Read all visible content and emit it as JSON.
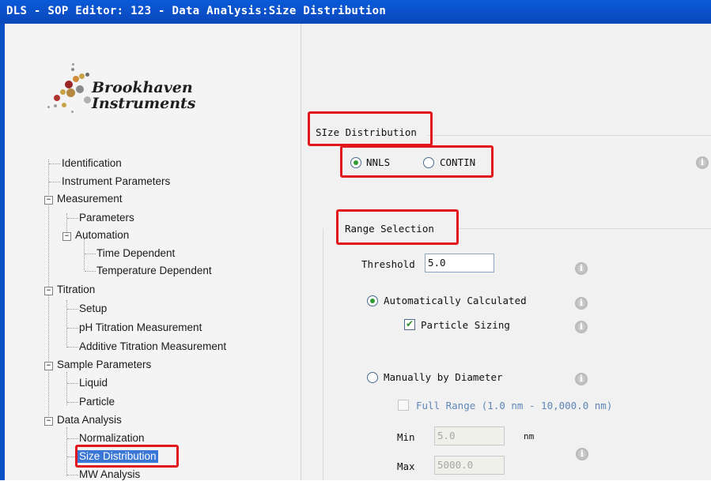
{
  "window": {
    "title": "DLS - SOP Editor: 123 - Data Analysis:Size Distribution"
  },
  "logo": {
    "line1": "Brookhaven",
    "line2": "Instruments"
  },
  "tree": {
    "identification": "Identification",
    "instrument_parameters": "Instrument Parameters",
    "measurement": "Measurement",
    "parameters": "Parameters",
    "automation": "Automation",
    "time_dependent": "Time Dependent",
    "temperature_dependent": "Temperature Dependent",
    "titration": "Titration",
    "setup": "Setup",
    "ph_titration": "pH Titration Measurement",
    "additive_titration": "Additive Titration Measurement",
    "sample_parameters": "Sample Parameters",
    "liquid": "Liquid",
    "particle": "Particle",
    "data_analysis": "Data Analysis",
    "normalization": "Normalization",
    "size_distribution": "Size Distribution",
    "mw_analysis": "MW Analysis",
    "expander_symbol": "−"
  },
  "size_distribution": {
    "group_title": "SIze Distribution",
    "nnls_label": "NNLS",
    "contin_label": "CONTIN",
    "selected": "NNLS"
  },
  "range_selection": {
    "group_title": "Range Selection",
    "threshold_label": "Threshold",
    "threshold_value": "5.0",
    "auto_label": "Automatically Calculated",
    "auto_selected": true,
    "particle_sizing_label": "Particle Sizing",
    "particle_sizing_checked": true,
    "manual_label": "Manually by Diameter",
    "manual_selected": false,
    "full_range_label": "Full Range (1.0 nm - 10,000.0 nm)",
    "min_label": "Min",
    "min_value": "5.0",
    "min_unit": "nm",
    "max_label": "Max",
    "max_value": "5000.0"
  },
  "colors": {
    "title_bar": "#0b4fc7",
    "highlight_box": "#e3161b",
    "tree_selection": "#3a76d6",
    "radio_dot": "#2e9b2e"
  },
  "icons": {
    "info": "info-icon",
    "info_glyph": "i"
  }
}
